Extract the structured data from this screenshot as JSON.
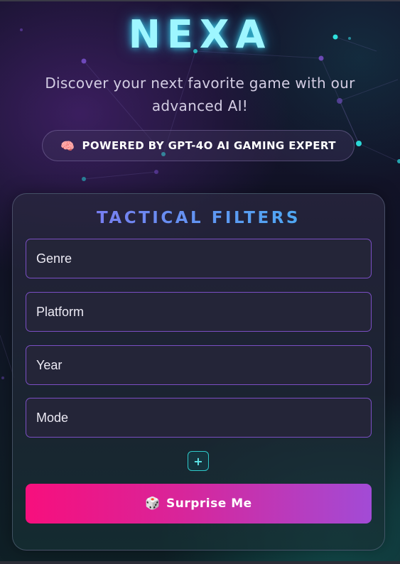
{
  "header": {
    "logo": "NEXA",
    "tagline": "Discover your next favorite game with our advanced AI!",
    "powered_badge": {
      "emoji": "🧠",
      "label": "POWERED BY GPT-4O AI GAMING EXPERT"
    }
  },
  "filters": {
    "title": "TACTICAL FILTERS",
    "fields": [
      {
        "label": "Genre"
      },
      {
        "label": "Platform"
      },
      {
        "label": "Year"
      },
      {
        "label": "Mode"
      }
    ],
    "add_button": {
      "icon": "plus-icon",
      "symbol": "+"
    },
    "surprise_button": {
      "emoji": "🎲",
      "label": "Surprise Me"
    }
  },
  "colors": {
    "logo": "#9ef6ff",
    "field_border": "#7b4fc4",
    "accent_teal": "#2ec9c9",
    "button_gradient_start": "#f70f7d",
    "button_gradient_end": "#a24bd6"
  }
}
